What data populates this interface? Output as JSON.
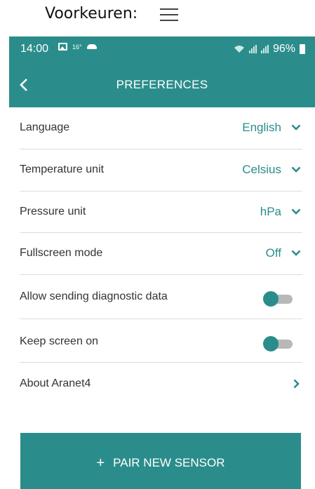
{
  "caption": {
    "text": "Voorkeuren:",
    "menu_icon": "hamburger-menu-icon"
  },
  "statusbar": {
    "time": "14:00",
    "temp": "16°",
    "battery": "96%"
  },
  "appbar": {
    "title": "PREFERENCES",
    "back_icon": "chevron-left-icon"
  },
  "settings": [
    {
      "label": "Language",
      "value": "English",
      "kind": "dropdown"
    },
    {
      "label": "Temperature unit",
      "value": "Celsius",
      "kind": "dropdown"
    },
    {
      "label": "Pressure unit",
      "value": "hPa",
      "kind": "dropdown"
    },
    {
      "label": "Fullscreen mode",
      "value": "Off",
      "kind": "dropdown"
    },
    {
      "label": "Allow sending diagnostic data",
      "kind": "toggle",
      "state": "off"
    },
    {
      "label": "Keep screen on",
      "kind": "toggle",
      "state": "off"
    },
    {
      "label": "About Aranet4",
      "kind": "link"
    }
  ],
  "pair_button": {
    "plus": "+",
    "label": "PAIR NEW SENSOR"
  },
  "colors": {
    "accent": "#2b8d8b",
    "divider": "#dcdcdc",
    "toggle_track": "#b8b8b8"
  }
}
